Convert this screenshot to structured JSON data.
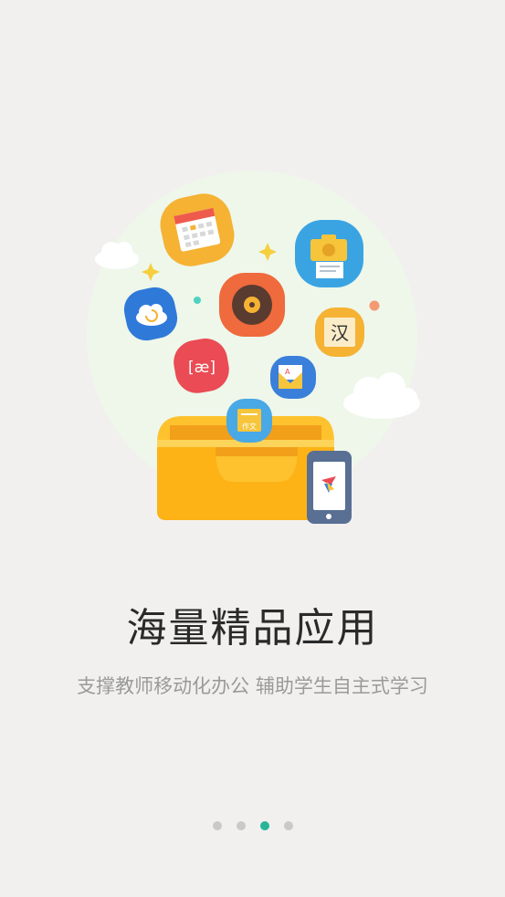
{
  "title": "海量精品应用",
  "subtitle": "支撑教师移动化办公 辅助学生自主式学习",
  "illustration": {
    "icons": [
      "calendar-icon",
      "camera-scanner-icon",
      "cloud-sync-icon",
      "record-icon",
      "chinese-char-icon",
      "phonetic-icon",
      "letter-icon",
      "composition-icon",
      "phone-app-icon",
      "app-box-icon"
    ],
    "labels": {
      "chinese_char": "汉",
      "phonetic": "[æ]",
      "composition": "作文"
    }
  },
  "pager": {
    "count": 4,
    "active_index": 2
  },
  "colors": {
    "background": "#f1f0ef",
    "circle": "#eef7ea",
    "accent": "#27b597",
    "dot_inactive": "#c9c9c9"
  }
}
